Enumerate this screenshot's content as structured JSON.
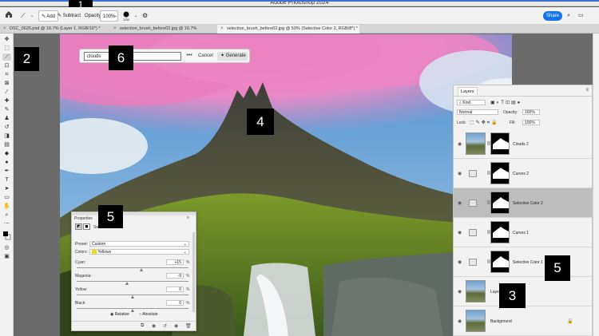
{
  "app": {
    "title": "Adobe Photoshop 2024",
    "share_label": "Share"
  },
  "options_bar": {
    "add_label": "Add",
    "subtract_label": "Subtract",
    "opacity_label": "Opacity:",
    "opacity_value": "100%",
    "brush_size": "1250"
  },
  "tabs": [
    {
      "label": "DSC_0625.psd @ 16.7% (Layer 1, RGB/16*) *"
    },
    {
      "label": "selection_brush_before02.jpg @ 16.7% (RGB/8*)"
    },
    {
      "label": "selection_brush_before02.jpg @ 50% (Selective Color 2, RGB/8*) *"
    }
  ],
  "generative_bar": {
    "prompt_value": "clouds",
    "more_label": "•••",
    "cancel_label": "Cancel",
    "generate_label": "Generate"
  },
  "callouts": [
    "1",
    "2",
    "3",
    "4",
    "5",
    "5",
    "6"
  ],
  "properties": {
    "title": "Properties",
    "adjustment_name": "Selective Color",
    "preset_label": "Preset:",
    "preset_value": "Custom",
    "colors_label": "Colors:",
    "colors_value": "Yellows",
    "colors_swatch": "#f5d90a",
    "sliders": [
      {
        "label": "Cyan:",
        "value": "+15",
        "level": 0.58
      },
      {
        "label": "Magenta:",
        "value": "-9",
        "level": 0.45
      },
      {
        "label": "Yellow:",
        "value": "0",
        "level": 0.5
      },
      {
        "label": "Black:",
        "value": "0",
        "level": 0.5
      }
    ],
    "percent_sign": "%",
    "relative_label": "Relative",
    "absolute_label": "Absolute"
  },
  "layers_panel": {
    "tab_label": "Layers",
    "kind_label": "Kind",
    "blend_mode": "Normal",
    "opacity_label": "Opacity:",
    "opacity_value": "100%",
    "lock_label": "Lock:",
    "fill_label": "Fill:",
    "fill_value": "100%",
    "layers": [
      {
        "name": "Clouds 2",
        "type": "generative"
      },
      {
        "name": "Curves 2",
        "type": "curves"
      },
      {
        "name": "Selective Color 2",
        "type": "selective-color",
        "selected": true
      },
      {
        "name": "Curves 1",
        "type": "curves"
      },
      {
        "name": "Selective Color 1",
        "type": "selective-color"
      },
      {
        "name": "Layer",
        "type": "photo"
      },
      {
        "name": "Background",
        "type": "photo"
      }
    ]
  }
}
